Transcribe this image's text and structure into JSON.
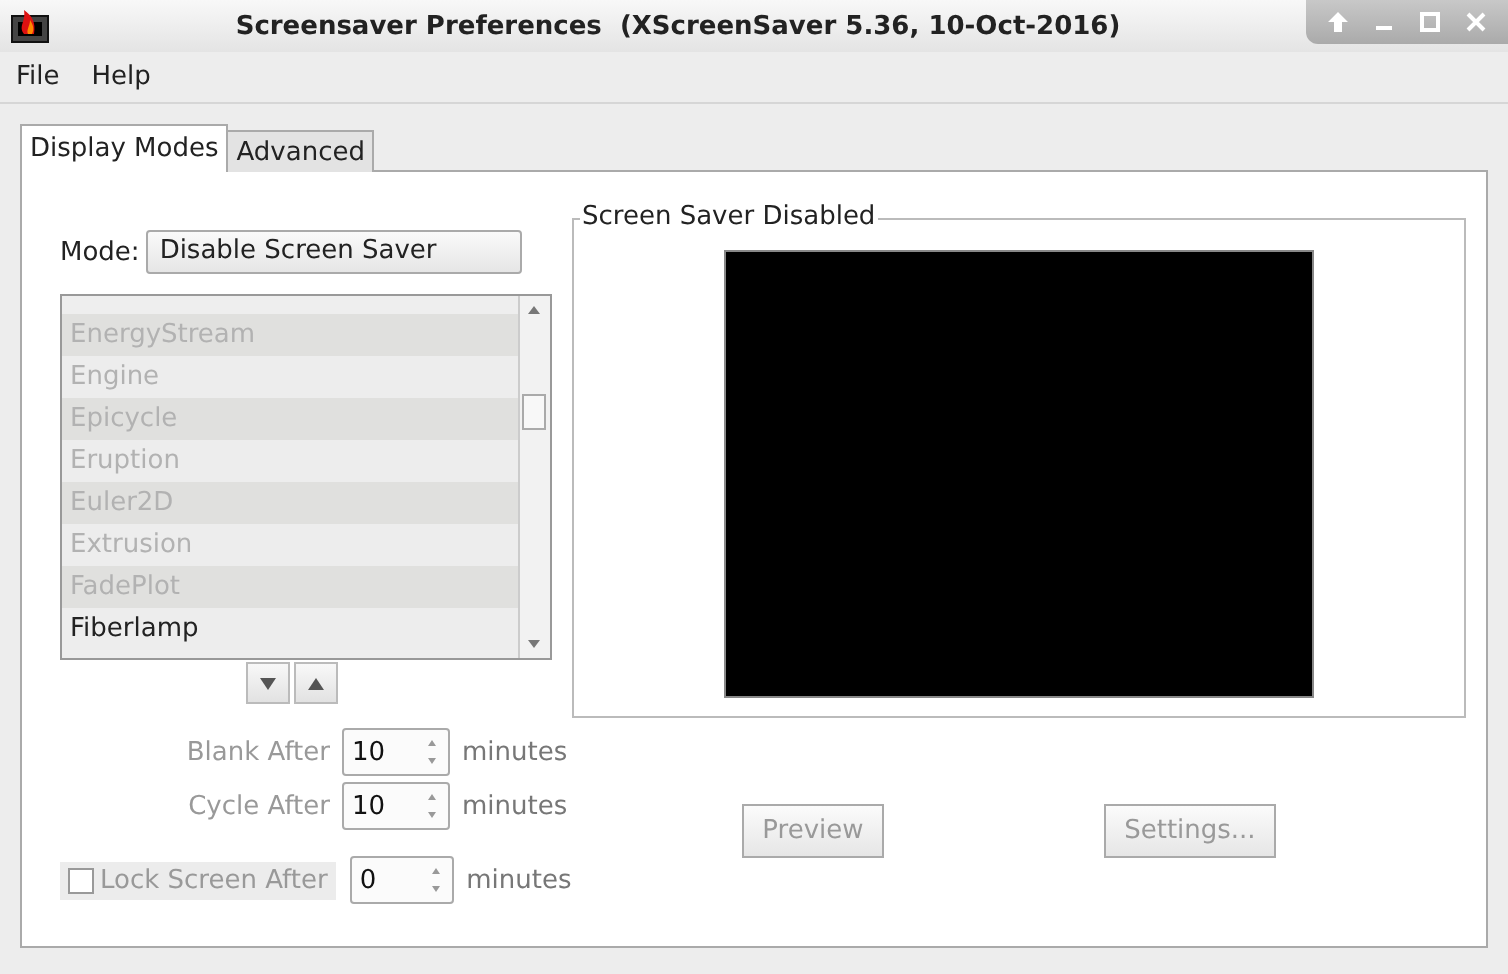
{
  "window": {
    "title": "Screensaver Preferences  (XScreenSaver 5.36, 10-Oct-2016)"
  },
  "menu": [
    {
      "label": "File"
    },
    {
      "label": "Help"
    }
  ],
  "tabs": [
    {
      "label": "Display Modes",
      "selected": true
    },
    {
      "label": "Advanced",
      "selected": false
    }
  ],
  "mode": {
    "label": "Mode:",
    "value": "Disable Screen Saver"
  },
  "modes_list": [
    {
      "label": "EnergyStream",
      "disabled": true
    },
    {
      "label": "Engine",
      "disabled": true
    },
    {
      "label": "Epicycle",
      "disabled": true
    },
    {
      "label": "Eruption",
      "disabled": true
    },
    {
      "label": "Euler2D",
      "disabled": true
    },
    {
      "label": "Extrusion",
      "disabled": true
    },
    {
      "label": "FadePlot",
      "disabled": true
    },
    {
      "label": "Fiberlamp",
      "disabled": false
    }
  ],
  "timers": [
    {
      "kind": "label",
      "label": "Blank After",
      "value": "10",
      "unit": "minutes",
      "disabled": true
    },
    {
      "kind": "label",
      "label": "Cycle After",
      "value": "10",
      "unit": "minutes",
      "disabled": true
    },
    {
      "kind": "checkbox",
      "label": "Lock Screen After",
      "value": "0",
      "unit": "minutes",
      "disabled": true,
      "checked": false
    }
  ],
  "preview": {
    "title": "Screen Saver Disabled"
  },
  "buttons": [
    {
      "label": "Preview",
      "disabled": true
    },
    {
      "label": "Settings...",
      "disabled": true
    }
  ]
}
